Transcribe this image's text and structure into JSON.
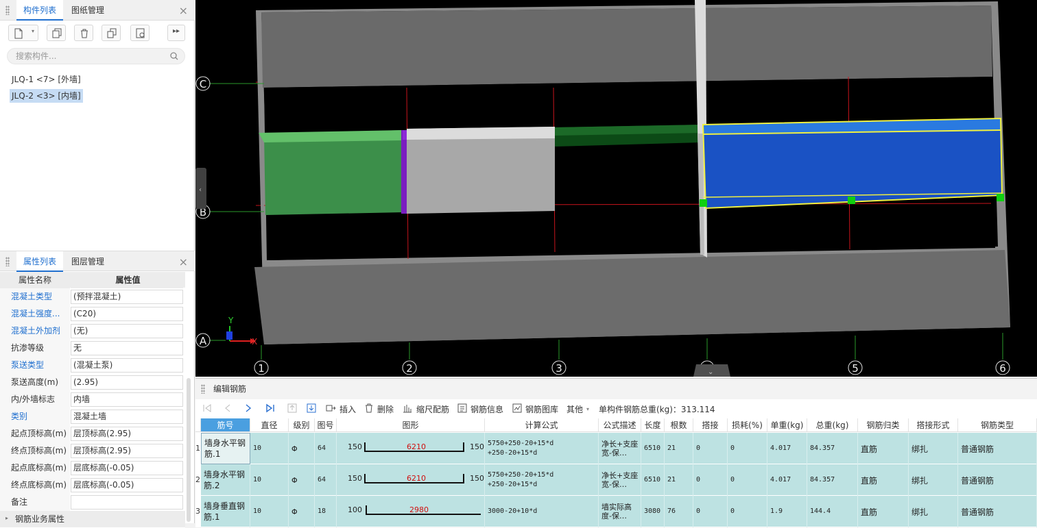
{
  "component_panel": {
    "tabs": [
      "构件列表",
      "图纸管理"
    ],
    "search_placeholder": "搜索构件...",
    "items": [
      "JLQ-1 <7> [外墙]",
      "JLQ-2 <3> [内墙]"
    ]
  },
  "property_panel": {
    "tabs": [
      "属性列表",
      "图层管理"
    ],
    "header_name": "属性名称",
    "header_value": "属性值",
    "rows": [
      {
        "name": "混凝土类型",
        "value": "(预拌混凝土)",
        "link": true
      },
      {
        "name": "混凝土强度...",
        "value": "(C20)",
        "link": true
      },
      {
        "name": "混凝土外加剂",
        "value": "(无)",
        "link": true
      },
      {
        "name": "抗渗等级",
        "value": "无",
        "link": false
      },
      {
        "name": "泵送类型",
        "value": "(混凝土泵)",
        "link": true
      },
      {
        "name": "泵送高度(m)",
        "value": "(2.95)",
        "link": false
      },
      {
        "name": "内/外墙标志",
        "value": "内墙",
        "link": false
      },
      {
        "name": "类别",
        "value": "混凝土墙",
        "link": true
      },
      {
        "name": "起点顶标高(m)",
        "value": "层顶标高(2.95)",
        "link": false
      },
      {
        "name": "终点顶标高(m)",
        "value": "层顶标高(2.95)",
        "link": false
      },
      {
        "name": "起点底标高(m)",
        "value": "层底标高(-0.05)",
        "link": false
      },
      {
        "name": "终点底标高(m)",
        "value": "层底标高(-0.05)",
        "link": false
      },
      {
        "name": "备注",
        "value": "",
        "link": false
      }
    ],
    "group_label": "钢筋业务属性"
  },
  "viewport": {
    "row_axes": [
      "C",
      "B",
      "A"
    ],
    "col_axes": [
      "1",
      "2",
      "3",
      "4",
      "5",
      "6"
    ],
    "axis_x": "X",
    "axis_y": "Y"
  },
  "rebar_editor": {
    "title": "编辑钢筋",
    "toolbar": {
      "insert": "插入",
      "delete": "删除",
      "scale": "缩尺配筋",
      "info": "钢筋信息",
      "library": "钢筋图库",
      "other": "其他",
      "total_label": "单构件钢筋总重(kg)：313.114"
    },
    "columns": [
      "筋号",
      "直径(mm)",
      "级别",
      "图号",
      "图形",
      "计算公式",
      "公式描述",
      "长度",
      "根数",
      "搭接",
      "损耗(%)",
      "单重(kg)",
      "总重(kg)",
      "钢筋归类",
      "搭接形式",
      "钢筋类型"
    ],
    "rows": [
      {
        "num": "1",
        "name": "墙身水平钢筋.1",
        "dia": "10",
        "grade": "Φ",
        "fig": "64",
        "left": "150",
        "mid": "6210",
        "right": "150",
        "formula1": "5750+250-20+15*d",
        "formula2": "+250-20+15*d",
        "desc1": "净长+支座",
        "desc2": "宽-保…",
        "len": "6510",
        "count": "21",
        "lap": "0",
        "loss": "0",
        "unit": "4.017",
        "total": "84.357",
        "cls": "直筋",
        "lapform": "绑扎",
        "type": "普通钢筋"
      },
      {
        "num": "2",
        "name": "墙身水平钢筋.2",
        "dia": "10",
        "grade": "Φ",
        "fig": "64",
        "left": "150",
        "mid": "6210",
        "right": "150",
        "formula1": "5750+250-20+15*d",
        "formula2": "+250-20+15*d",
        "desc1": "净长+支座",
        "desc2": "宽-保…",
        "len": "6510",
        "count": "21",
        "lap": "0",
        "loss": "0",
        "unit": "4.017",
        "total": "84.357",
        "cls": "直筋",
        "lapform": "绑扎",
        "type": "普通钢筋"
      },
      {
        "num": "3",
        "name": "墙身垂直钢筋.1",
        "dia": "10",
        "grade": "Φ",
        "fig": "18",
        "left": "100",
        "mid": "2980",
        "right": "",
        "formula1": "3000-20+10*d",
        "formula2": "",
        "desc1": "墙实际高",
        "desc2": "度-保…",
        "len": "3080",
        "count": "76",
        "lap": "0",
        "loss": "0",
        "unit": "1.9",
        "total": "144.4",
        "cls": "直筋",
        "lapform": "绑扎",
        "type": "普通钢筋"
      }
    ]
  },
  "colors": {
    "accent": "#1f6fcf",
    "selected_wall": "#1a52c4",
    "green_wall": "#3c8f4a",
    "row_bg": "#bde2e2"
  }
}
